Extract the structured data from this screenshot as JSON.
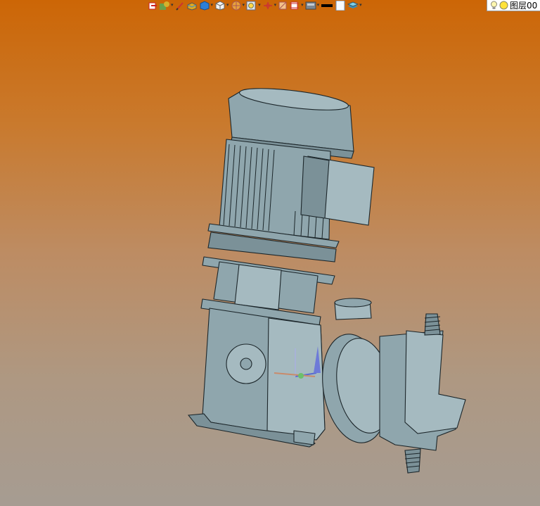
{
  "toolbar": {
    "layer_name": "图层00",
    "buttons": [
      {
        "icon": "exit-sketch-icon",
        "dropdown": false
      },
      {
        "icon": "view-orient-icon",
        "dropdown": true
      },
      {
        "icon": "pen-icon",
        "dropdown": false
      },
      {
        "icon": "shaded-box-icon",
        "dropdown": false
      },
      {
        "icon": "blue-cube-icon",
        "dropdown": true
      },
      {
        "icon": "white-cube-icon",
        "dropdown": true
      },
      {
        "icon": "render-sphere-icon",
        "dropdown": true
      },
      {
        "icon": "zoom-fit-icon",
        "dropdown": true
      },
      {
        "icon": "axis-triad-icon",
        "dropdown": true
      },
      {
        "icon": "section-view-icon",
        "dropdown": false
      },
      {
        "icon": "frame-icon",
        "dropdown": true
      },
      {
        "icon": "display-style-icon",
        "dropdown": true
      },
      {
        "icon": "line-color-icon",
        "dropdown": false
      },
      {
        "icon": "blank-page-icon",
        "dropdown": false
      },
      {
        "icon": "layers-icon",
        "dropdown": true
      }
    ]
  },
  "colors": {
    "background_top": "#cc6606",
    "background_bottom": "#a69c92",
    "model_fill": "#8fa6ad",
    "model_edge": "#1c262a"
  }
}
